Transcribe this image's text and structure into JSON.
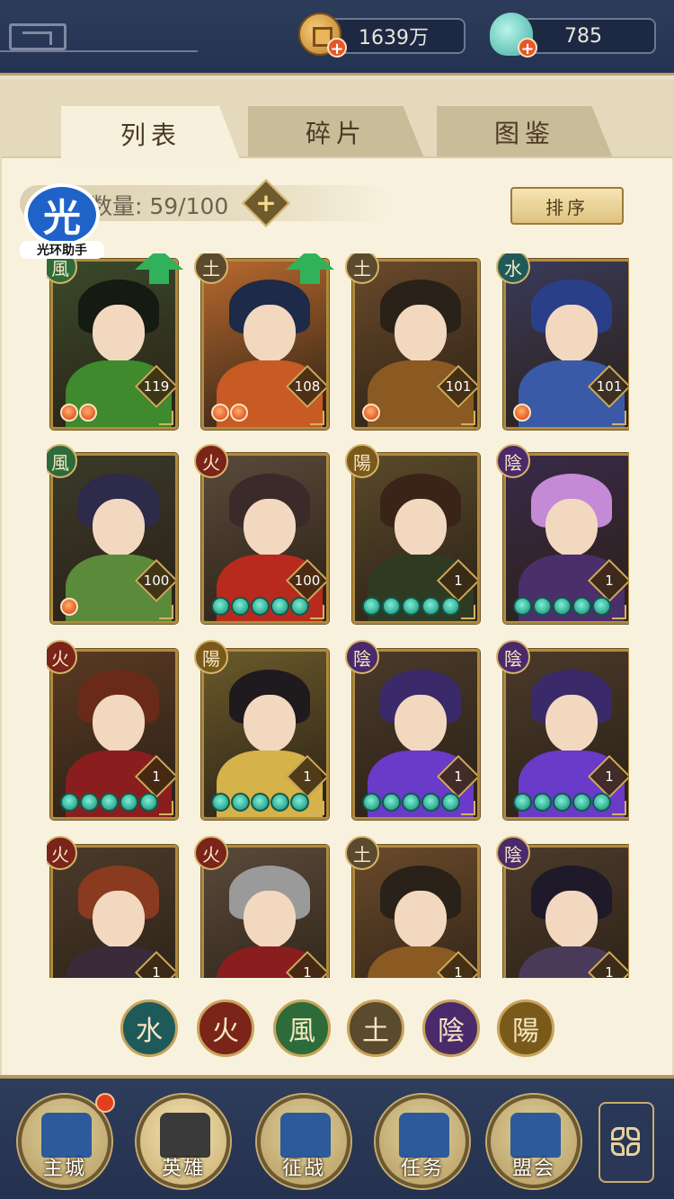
{
  "resources": {
    "coins": "1639万",
    "jade": "785"
  },
  "tabs": [
    {
      "label": "列表",
      "active": true
    },
    {
      "label": "碎片",
      "active": false
    },
    {
      "label": "图鉴",
      "active": false
    }
  ],
  "roster": {
    "count_text": "数量: 59/100",
    "add_symbol": "+",
    "sort_label": "排序"
  },
  "watermark": {
    "glyph": "光",
    "text": "光环助手"
  },
  "heroes": [
    {
      "element": "風",
      "level": "119",
      "star_type": "red",
      "stars": 2,
      "upgrade": true,
      "palette": [
        "#3a4a2a",
        "#151a12",
        "#3e8a2c"
      ]
    },
    {
      "element": "土",
      "level": "108",
      "star_type": "red",
      "stars": 2,
      "upgrade": true,
      "palette": [
        "#b8692e",
        "#1d2a48",
        "#c85a24"
      ]
    },
    {
      "element": "土",
      "level": "101",
      "star_type": "red",
      "stars": 1,
      "upgrade": false,
      "palette": [
        "#6a4a2a",
        "#2a2218",
        "#8a5a22"
      ]
    },
    {
      "element": "水",
      "level": "101",
      "star_type": "red",
      "stars": 1,
      "upgrade": false,
      "palette": [
        "#3a3a5a",
        "#2a3f8a",
        "#3a5aa8"
      ]
    },
    {
      "element": "風",
      "level": "100",
      "star_type": "red",
      "stars": 1,
      "upgrade": false,
      "palette": [
        "#3a3a2a",
        "#2d2a4a",
        "#5a8a3a"
      ]
    },
    {
      "element": "火",
      "level": "100",
      "star_type": "teal",
      "stars": 5,
      "upgrade": false,
      "palette": [
        "#5a4a3a",
        "#3a2a2a",
        "#b82a1e"
      ]
    },
    {
      "element": "陽",
      "level": "1",
      "star_type": "teal",
      "stars": 5,
      "upgrade": false,
      "palette": [
        "#5a4a2a",
        "#3a2418",
        "#2f3a22"
      ]
    },
    {
      "element": "陰",
      "level": "1",
      "star_type": "teal",
      "stars": 5,
      "upgrade": false,
      "palette": [
        "#3a2a4a",
        "#c48ad6",
        "#4a2f6a"
      ]
    },
    {
      "element": "火",
      "level": "1",
      "star_type": "teal",
      "stars": 5,
      "upgrade": false,
      "palette": [
        "#5a3a22",
        "#6a2a1a",
        "#8a1e1e"
      ]
    },
    {
      "element": "陽",
      "level": "1",
      "star_type": "teal",
      "stars": 5,
      "upgrade": false,
      "palette": [
        "#6a5a2a",
        "#1e1a1e",
        "#d6b24a"
      ]
    },
    {
      "element": "陰",
      "level": "1",
      "star_type": "teal",
      "stars": 5,
      "upgrade": false,
      "palette": [
        "#4a3a2a",
        "#3a2a6a",
        "#6a3ac8"
      ]
    },
    {
      "element": "陰",
      "level": "1",
      "star_type": "teal",
      "stars": 5,
      "upgrade": false,
      "palette": [
        "#4a3a2a",
        "#3a2a6a",
        "#6a3ac8"
      ]
    },
    {
      "element": "火",
      "level": "1",
      "star_type": "none",
      "stars": 0,
      "upgrade": false,
      "palette": [
        "#4a3a2a",
        "#8a3a1e",
        "#3a2a3a"
      ]
    },
    {
      "element": "火",
      "level": "1",
      "star_type": "none",
      "stars": 0,
      "upgrade": false,
      "palette": [
        "#5a4a3a",
        "#9a9a9a",
        "#8a1e1e"
      ]
    },
    {
      "element": "土",
      "level": "1",
      "star_type": "none",
      "stars": 0,
      "upgrade": false,
      "palette": [
        "#6a4a2a",
        "#2a2218",
        "#8a5a22"
      ]
    },
    {
      "element": "陰",
      "level": "1",
      "star_type": "none",
      "stars": 0,
      "upgrade": false,
      "palette": [
        "#4a3a2a",
        "#1e1a2a",
        "#4a3a5a"
      ]
    }
  ],
  "element_colors": {
    "風": "#2d6b3a",
    "土": "#5a4a2e",
    "水": "#1f5a5a",
    "火": "#7a241a",
    "陽": "#7a5a1a",
    "陰": "#4a2a6a"
  },
  "element_filters": [
    "水",
    "火",
    "風",
    "土",
    "陰",
    "陽"
  ],
  "nav": [
    {
      "label": "主城",
      "notify": true,
      "active": false
    },
    {
      "label": "英雄",
      "notify": false,
      "active": true
    },
    {
      "label": "征战",
      "notify": false,
      "active": false
    },
    {
      "label": "任务",
      "notify": false,
      "active": false
    },
    {
      "label": "盟会",
      "notify": false,
      "active": false
    }
  ],
  "icons": {
    "coin": "copper-coin-icon",
    "jade": "jade-shell-icon",
    "menu": "clover-menu-icon"
  }
}
